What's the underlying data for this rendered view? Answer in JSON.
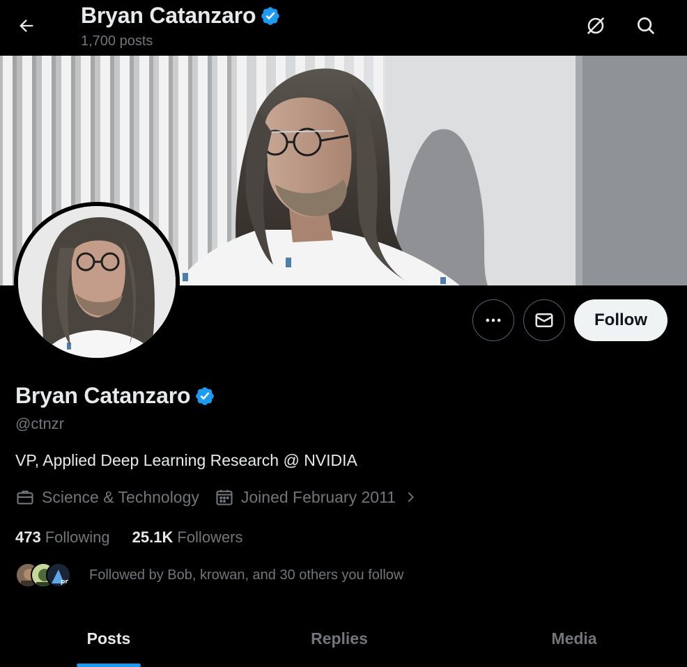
{
  "header": {
    "title": "Bryan Catanzaro",
    "subtitle": "1,700 posts",
    "icons": [
      "back-arrow-icon",
      "no-sparkle-icon",
      "search-icon"
    ]
  },
  "profile": {
    "name": "Bryan Catanzaro",
    "verified_badge_color": "#1d9bf0",
    "handle": "@ctnzr",
    "bio": "VP, Applied Deep Learning Research @ NVIDIA",
    "category": "Science & Technology",
    "joined": "Joined February 2011"
  },
  "actions": {
    "more_icon": "more-dots-icon",
    "message_icon": "envelope-icon",
    "follow_label": "Follow"
  },
  "stats": {
    "following_count": "473",
    "following_label": "Following",
    "followers_count": "25.1K",
    "followers_label": "Followers"
  },
  "followed_by": {
    "text": "Followed by Bob, krowan, and 30 others you follow"
  },
  "tabs": [
    {
      "label": "Posts",
      "active": true
    },
    {
      "label": "Replies",
      "active": false
    },
    {
      "label": "Media",
      "active": false
    }
  ],
  "colors": {
    "accent": "#1d9bf0",
    "background": "#000000",
    "muted_text": "#71767b"
  }
}
